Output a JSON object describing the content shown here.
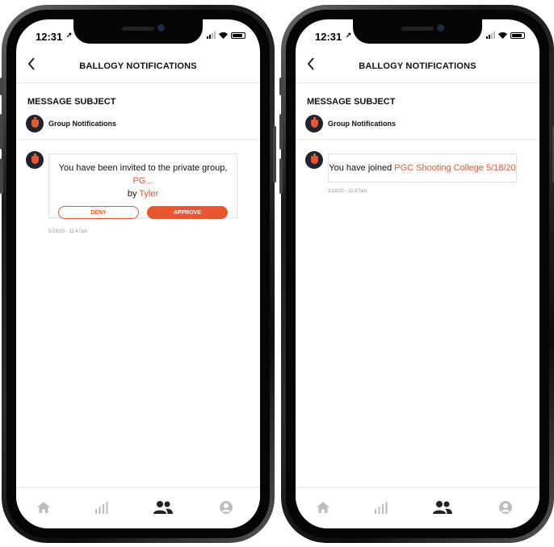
{
  "colors": {
    "accent": "#e8552e",
    "tab_inactive": "#bdbdbd",
    "tab_active": "#222222"
  },
  "left_screen": {
    "status": {
      "time": "12:31"
    },
    "header": {
      "title": "BALLOGY NOTIFICATIONS"
    },
    "subject_label": "MESSAGE SUBJECT",
    "group_name": "Group Notifications",
    "message": {
      "text_prefix": "You have been invited to the private group,",
      "group_link": "PG...",
      "by_label": "by",
      "user_link": "Tyler"
    },
    "deny_label": "DENY",
    "approve_label": "APPROVE",
    "timestamp": "5/18/20 - 11:47am",
    "tabs": [
      {
        "icon": "home-icon"
      },
      {
        "icon": "stats-icon"
      },
      {
        "icon": "groups-icon",
        "active": true
      },
      {
        "icon": "profile-icon"
      }
    ]
  },
  "right_screen": {
    "status": {
      "time": "12:31"
    },
    "header": {
      "title": "BALLOGY NOTIFICATIONS"
    },
    "subject_label": "MESSAGE SUBJECT",
    "group_name": "Group Notifications",
    "message": {
      "text_prefix": "You have joined",
      "group_link": "PGC Shooting College 5/18/20"
    },
    "timestamp": "5/18/20 - 11:47am",
    "tabs": [
      {
        "icon": "home-icon"
      },
      {
        "icon": "stats-icon"
      },
      {
        "icon": "groups-icon",
        "active": true
      },
      {
        "icon": "profile-icon"
      }
    ]
  }
}
